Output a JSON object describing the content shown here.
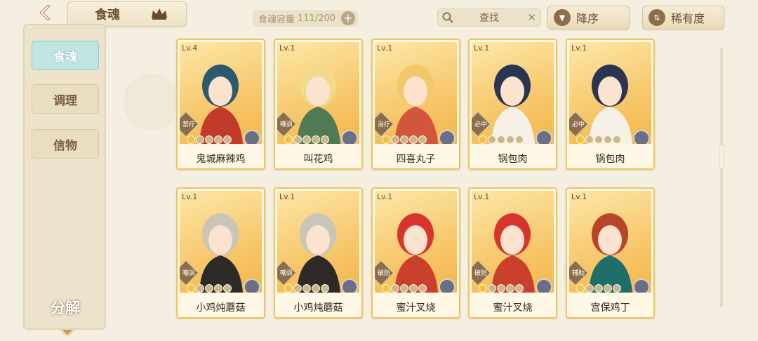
{
  "header": {
    "title": "食魂",
    "capacity_label": "食魂容量",
    "capacity_current": "111",
    "capacity_max": "/200",
    "capacity_add": "+",
    "search_placeholder": "查找",
    "search_clear": "✕",
    "sort_order_label": "降序",
    "sort_rarity_label": "稀有度"
  },
  "sidebar": {
    "tabs": [
      {
        "label": "食魂",
        "active": true
      },
      {
        "label": "调理",
        "active": false
      },
      {
        "label": "信物",
        "active": false
      }
    ],
    "decompose_label": "分解"
  },
  "cards": [
    {
      "level": "Lv.4",
      "role": "禁疗",
      "name": "鬼城麻辣鸡",
      "stars_on": 1,
      "hair": "#2b5a6e",
      "accent": "#c23a2a"
    },
    {
      "level": "Lv.1",
      "role": "嘲讽",
      "name": "叫花鸡",
      "stars_on": 1,
      "hair": "#f3d98a",
      "accent": "#4f7a53"
    },
    {
      "level": "Lv.1",
      "role": "治疗",
      "name": "四喜丸子",
      "stars_on": 1,
      "hair": "#f2c96a",
      "accent": "#d2563b"
    },
    {
      "level": "Lv.1",
      "role": "必中",
      "name": "锅包肉",
      "stars_on": 1,
      "hair": "#2a3551",
      "accent": "#f6f1e6"
    },
    {
      "level": "Lv.1",
      "role": "必中",
      "name": "锅包肉",
      "stars_on": 1,
      "hair": "#2a3551",
      "accent": "#f6f1e6"
    },
    {
      "level": "Lv.1",
      "role": "嘲讽",
      "name": "小鸡炖蘑菇",
      "stars_on": 1,
      "hair": "#c9c6b8",
      "accent": "#2d2a28"
    },
    {
      "level": "Lv.1",
      "role": "嘲讽",
      "name": "小鸡炖蘑菇",
      "stars_on": 1,
      "hair": "#c9c6b8",
      "accent": "#2d2a28"
    },
    {
      "level": "Lv.1",
      "role": "破防",
      "name": "蜜汁叉烧",
      "stars_on": 1,
      "hair": "#d8342c",
      "accent": "#c9412d"
    },
    {
      "level": "Lv.1",
      "role": "破防",
      "name": "蜜汁叉烧",
      "stars_on": 1,
      "hair": "#d8342c",
      "accent": "#c9412d"
    },
    {
      "level": "Lv.1",
      "role": "辅助",
      "name": "宫保鸡丁",
      "stars_on": 1,
      "hair": "#b8442a",
      "accent": "#1f6e6a"
    }
  ]
}
